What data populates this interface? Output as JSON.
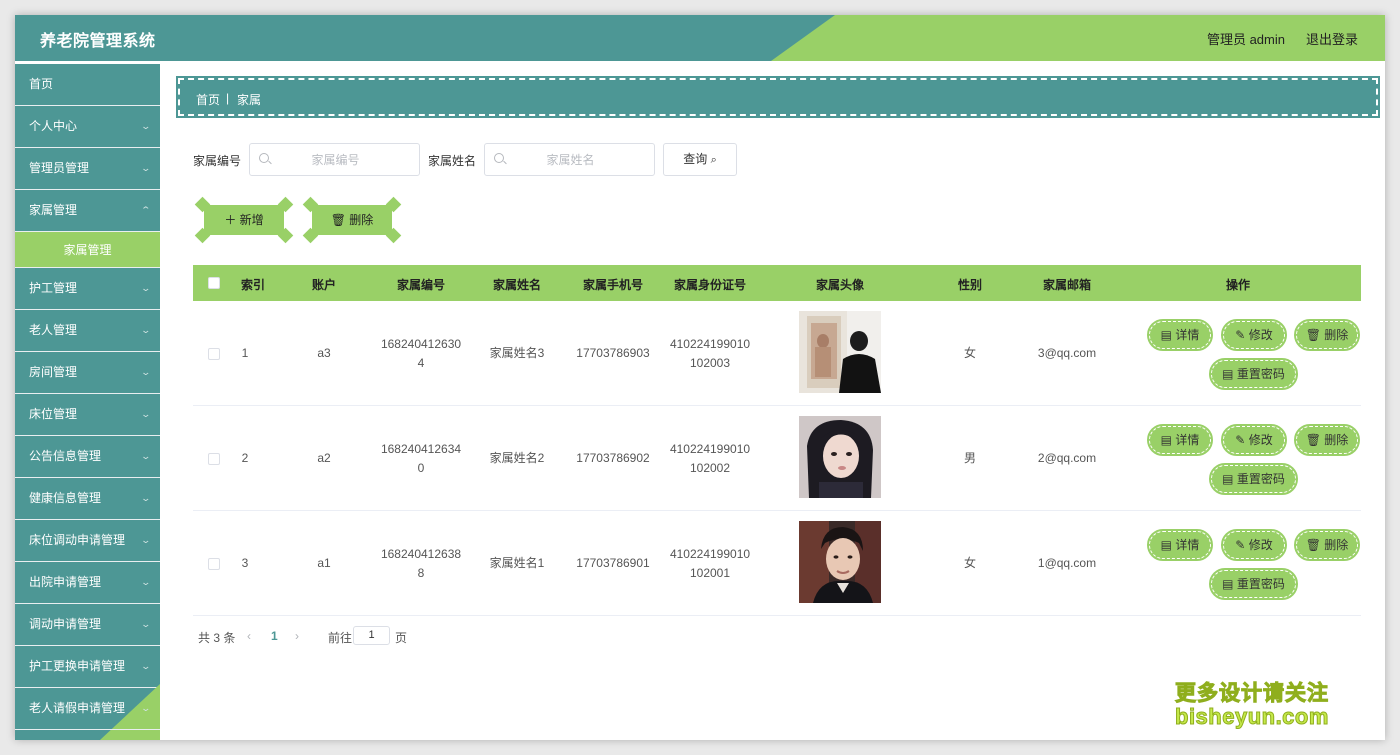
{
  "header": {
    "title": "养老院管理系统",
    "user": "管理员 admin",
    "logout": "退出登录"
  },
  "sidebar": {
    "items": [
      {
        "label": "首页",
        "chevron": false
      },
      {
        "label": "个人中心",
        "chevron": true
      },
      {
        "label": "管理员管理",
        "chevron": true
      },
      {
        "label": "家属管理",
        "chevron": true
      },
      {
        "label": "护工管理",
        "chevron": true
      },
      {
        "label": "老人管理",
        "chevron": true
      },
      {
        "label": "房间管理",
        "chevron": true
      },
      {
        "label": "床位管理",
        "chevron": true
      },
      {
        "label": "公告信息管理",
        "chevron": true
      },
      {
        "label": "健康信息管理",
        "chevron": true
      },
      {
        "label": "床位调动申请管理",
        "chevron": true
      },
      {
        "label": "出院申请管理",
        "chevron": true
      },
      {
        "label": "调动申请管理",
        "chevron": true
      },
      {
        "label": "护工更换申请管理",
        "chevron": true
      },
      {
        "label": "老人请假申请管理",
        "chevron": true
      }
    ],
    "active_sub": "家属管理"
  },
  "breadcrumb": {
    "home": "首页",
    "sep": "|",
    "current": "家属"
  },
  "search": {
    "field1_label": "家属编号",
    "field1_placeholder": "家属编号",
    "field2_label": "家属姓名",
    "field2_placeholder": "家属姓名",
    "query_label": "查询"
  },
  "actions": {
    "add": "新增",
    "delete": "删除"
  },
  "table": {
    "headers": [
      "索引",
      "账户",
      "家属编号",
      "家属姓名",
      "家属手机号",
      "家属身份证号",
      "家属头像",
      "性别",
      "家属邮箱",
      "操作"
    ],
    "rows": [
      {
        "index": "1",
        "account": "a3",
        "id1": "168240412630",
        "id2": "4",
        "name": "家属姓名3",
        "phone": "17703786903",
        "idcard1": "410224199010",
        "idcard2": "102003",
        "gender": "女",
        "email": "3@qq.com"
      },
      {
        "index": "2",
        "account": "a2",
        "id1": "168240412634",
        "id2": "0",
        "name": "家属姓名2",
        "phone": "17703786902",
        "idcard1": "410224199010",
        "idcard2": "102002",
        "gender": "男",
        "email": "2@qq.com"
      },
      {
        "index": "3",
        "account": "a1",
        "id1": "168240412638",
        "id2": "8",
        "name": "家属姓名1",
        "phone": "17703786901",
        "idcard1": "410224199010",
        "idcard2": "102001",
        "gender": "女",
        "email": "1@qq.com"
      }
    ],
    "row_actions": {
      "detail": "详情",
      "edit": "修改",
      "delete": "删除",
      "reset": "重置密码"
    }
  },
  "pagination": {
    "total": "共 3 条",
    "prev": "‹",
    "current": "1",
    "next": "›",
    "goto": "前往",
    "page_value": "1",
    "page_unit": "页"
  },
  "watermark": {
    "line1": "更多设计请关注",
    "line2": "bisheyun.com"
  },
  "colors": {
    "teal": "#4d9795",
    "green": "#99d067"
  }
}
